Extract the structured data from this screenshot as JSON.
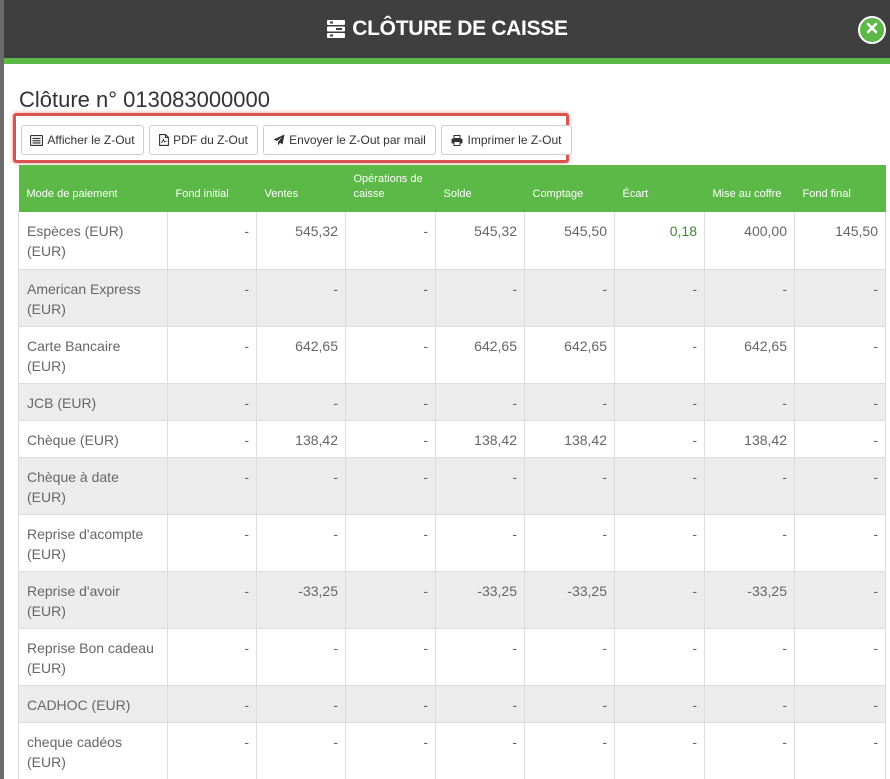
{
  "header": {
    "title": "CLÔTURE DE CAISSE"
  },
  "page": {
    "title": "Clôture n° 013083000000"
  },
  "toolbar": {
    "show_label": "Afficher le Z-Out",
    "pdf_label": "PDF du Z-Out",
    "mail_label": "Envoyer le Z-Out par mail",
    "print_label": "Imprimer le Z-Out"
  },
  "table": {
    "columns": [
      "Mode de paiement",
      "Fond initial",
      "Ventes",
      "Opérations de caisse",
      "Solde",
      "Comptage",
      "Écart",
      "Mise au coffre",
      "Fond final"
    ],
    "rows": [
      [
        "Espèces (EUR) (EUR)",
        "-",
        "545,32",
        "-",
        "545,32",
        "545,50",
        "0,18",
        "400,00",
        "145,50"
      ],
      [
        "American Express (EUR)",
        "-",
        "-",
        "-",
        "-",
        "-",
        "-",
        "-",
        "-"
      ],
      [
        "Carte Bancaire (EUR)",
        "-",
        "642,65",
        "-",
        "642,65",
        "642,65",
        "-",
        "642,65",
        "-"
      ],
      [
        "JCB (EUR)",
        "-",
        "-",
        "-",
        "-",
        "-",
        "-",
        "-",
        "-"
      ],
      [
        "Chèque (EUR)",
        "-",
        "138,42",
        "-",
        "138,42",
        "138,42",
        "-",
        "138,42",
        "-"
      ],
      [
        "Chèque à date (EUR)",
        "-",
        "-",
        "-",
        "-",
        "-",
        "-",
        "-",
        "-"
      ],
      [
        "Reprise d'acompte (EUR)",
        "-",
        "-",
        "-",
        "-",
        "-",
        "-",
        "-",
        "-"
      ],
      [
        "Reprise d'avoir (EUR)",
        "-",
        "-33,25",
        "-",
        "-33,25",
        "-33,25",
        "-",
        "-33,25",
        "-"
      ],
      [
        "Reprise Bon cadeau (EUR)",
        "-",
        "-",
        "-",
        "-",
        "-",
        "-",
        "-",
        "-"
      ],
      [
        "CADHOC (EUR)",
        "-",
        "-",
        "-",
        "-",
        "-",
        "-",
        "-",
        "-"
      ],
      [
        "cheque cadéos (EUR)",
        "-",
        "-",
        "-",
        "-",
        "-",
        "-",
        "-",
        "-"
      ]
    ]
  },
  "colors": {
    "accent": "#5cb947",
    "header_bg": "#3f3f3f",
    "highlight_border": "#d9534f",
    "positive_value": "#3c8a2e"
  },
  "icons": {
    "header": "cash-register-icon",
    "close": "close-icon",
    "show": "list-alt-icon",
    "pdf": "file-pdf-icon",
    "mail": "paper-plane-icon",
    "print": "print-icon"
  }
}
